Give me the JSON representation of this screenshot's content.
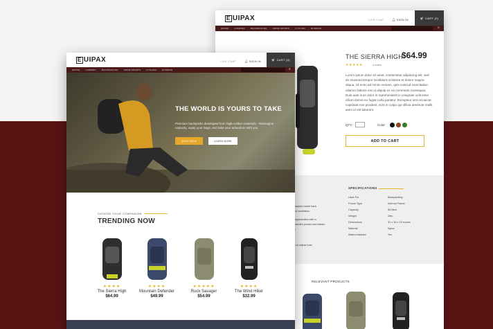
{
  "brand": {
    "logo_box": "E",
    "logo_rest": "UIPAX"
  },
  "header": {
    "live_chat": "LIVE CHAT",
    "sign_in": "SIGN IN",
    "cart": "CART (0)"
  },
  "nav": [
    "HIKING",
    "CAMPING",
    "BACKPACKING",
    "SNOW SPORTS",
    "CYCLING",
    "RUNNING"
  ],
  "product": {
    "title": "THE SIERRA HIGH",
    "price": "$64.99",
    "rating": 4.5,
    "reviews": "4 review",
    "description": "Lorem ipsum dolor sit amet, consectetur adipiscing elit, sed do eiusmod tempor incididunt ut labore et dolore magna aliqua. Ut enim ad minim veniam, quis nostrud exercitation ullamco laboris nisi ut aliquip ex ea commodo consequat. Duis aute irure dolor in reprehenderit in voluptate velit esse cillum dolore eu fugiat nulla pariatur. Excepteur sint occaecat cupidatat non proident, sunt in culpa qui officia deserunt mollit anim id est laborum.",
    "qty_label": "QTY:",
    "color_label": "Color:",
    "colors": [
      "#111111",
      "#8a4a22",
      "#3a7a2a"
    ],
    "add_to_cart": "ADD TO CART"
  },
  "specs": {
    "heading": "SPECIFICATIONS",
    "rows": [
      {
        "k": "Uses For",
        "v": "Backpacking"
      },
      {
        "k": "Frame Type",
        "v": "Internal Frame"
      },
      {
        "k": "Capacity",
        "v": "55 liters"
      },
      {
        "k": "Weight",
        "v": "2lbs"
      },
      {
        "k": "Dimensions",
        "v": "31 x 16 x 15 inches"
      },
      {
        "k": "Material",
        "v": "Nylon"
      },
      {
        "k": "Water-resistant",
        "v": "Yes"
      }
    ],
    "left_fragments": [
      "padded mesh back",
      "ed ventilation",
      "organization with a",
      "panded pocket and elastic",
      "s",
      "y to adjust load"
    ]
  },
  "relevant_heading": "RELEVANT PRODUCTS",
  "hero": {
    "title": "THE WORLD IS YOURS TO TAKE",
    "text": "Premium backpacks developed from high-caliber materials - Reimagine capacity, equip your bags, and take your adventure with you",
    "shop_now": "SHOP NOW",
    "learn_more": "LEARN MORE"
  },
  "trending": {
    "kicker": "CHOOSE YOUR COMPANION",
    "title": "TRENDING NOW",
    "items": [
      {
        "name": "The Sierra High",
        "price": "$64.99",
        "stars": "★★★★",
        "rating": 4.5
      },
      {
        "name": "Mountain Defender",
        "price": "$49.99",
        "stars": "★★★★",
        "rating": 4
      },
      {
        "name": "Ruck Savager",
        "price": "$54.99",
        "stars": "★★★★★",
        "rating": 5
      },
      {
        "name": "The Wind Hiker",
        "price": "$32.99",
        "stars": "★★★★",
        "rating": 4.5
      }
    ]
  }
}
